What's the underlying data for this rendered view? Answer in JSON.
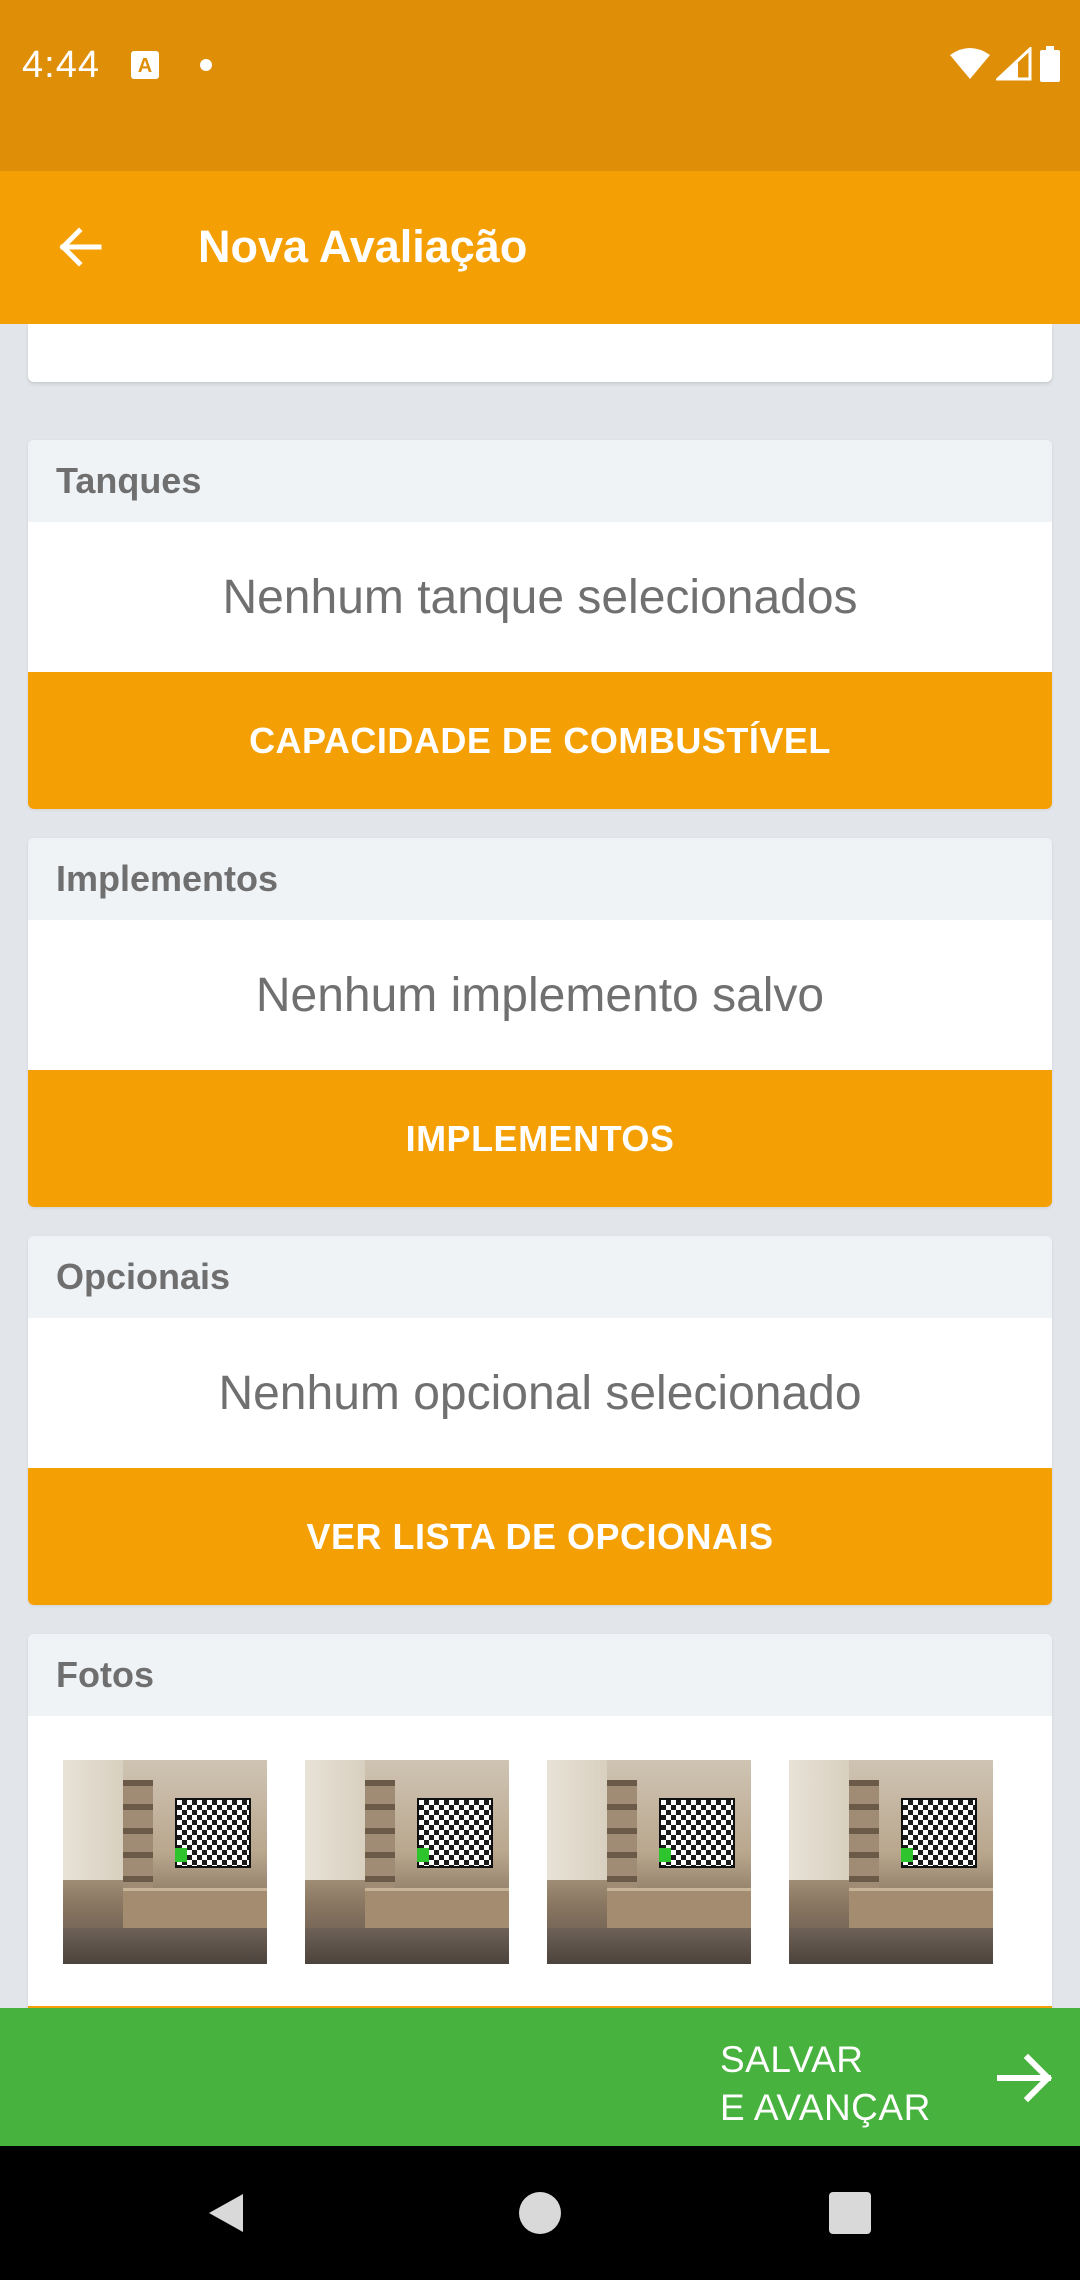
{
  "status_bar": {
    "time": "4:44",
    "icons": [
      "autofill-a-icon",
      "notification-dot-icon",
      "wifi-icon",
      "signal-icon",
      "battery-icon"
    ]
  },
  "app_bar": {
    "title": "Nova Avaliação",
    "back_icon": "arrow-left-icon"
  },
  "sections": {
    "tanques": {
      "header": "Tanques",
      "empty_text": "Nenhum tanque selecionados",
      "button": "CAPACIDADE DE COMBUSTÍVEL"
    },
    "implementos": {
      "header": "Implementos",
      "empty_text": "Nenhum implemento salvo",
      "button": "IMPLEMENTOS"
    },
    "opcionais": {
      "header": "Opcionais",
      "empty_text": "Nenhum opcional selecionado",
      "button": "VER LISTA DE OPCIONAIS"
    },
    "fotos": {
      "header": "Fotos",
      "photo_count": 4
    }
  },
  "bottom_action": {
    "label_line1": "SALVAR",
    "label_line2": "E AVANÇAR",
    "icon": "arrow-right-icon"
  },
  "colors": {
    "status_bar": "#df8f07",
    "primary": "#f4a005",
    "action_green": "#47b23d",
    "background": "#e2e6ea"
  }
}
